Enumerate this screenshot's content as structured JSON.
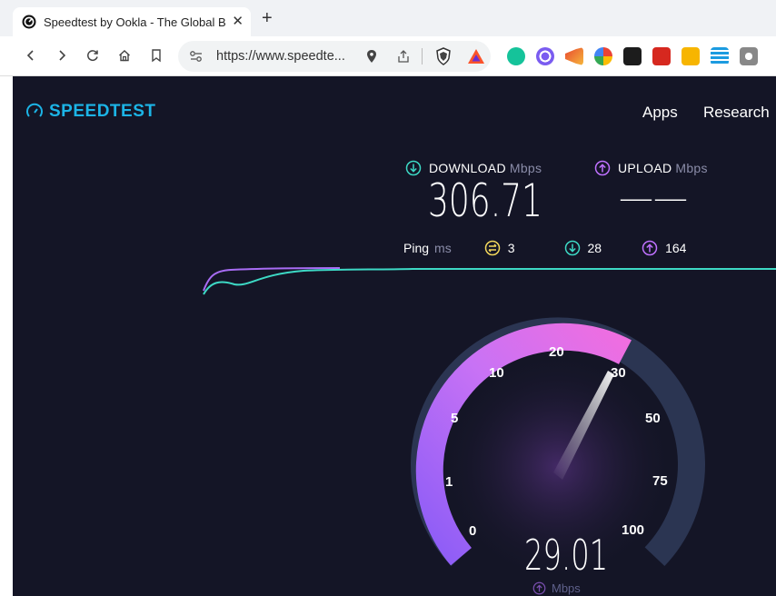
{
  "browser": {
    "tab_title": "Speedtest by Ookla - The Global B",
    "tab_close": "✕",
    "new_tab": "+",
    "url": "https://www.speedte..."
  },
  "site": {
    "logo_text": "SPEEDTEST",
    "nav": [
      "Apps",
      "Research"
    ]
  },
  "results": {
    "download_label": "DOWNLOAD",
    "download_unit": "Mbps",
    "download_value": "306.71",
    "upload_label": "UPLOAD",
    "upload_unit": "Mbps",
    "upload_value": "——",
    "ping_label": "Ping",
    "ping_unit": "ms",
    "ping_idle": "3",
    "ping_download": "28",
    "ping_upload": "164"
  },
  "gauge": {
    "ticks": [
      "0",
      "1",
      "5",
      "10",
      "20",
      "30",
      "50",
      "75",
      "100"
    ],
    "value": "29.01",
    "unit": "Mbps"
  },
  "colors": {
    "background": "#141526",
    "accent": "#1cb4e6",
    "download": "#3dd9c5",
    "upload": "#bf71ff",
    "ping": "#f3d85c"
  }
}
